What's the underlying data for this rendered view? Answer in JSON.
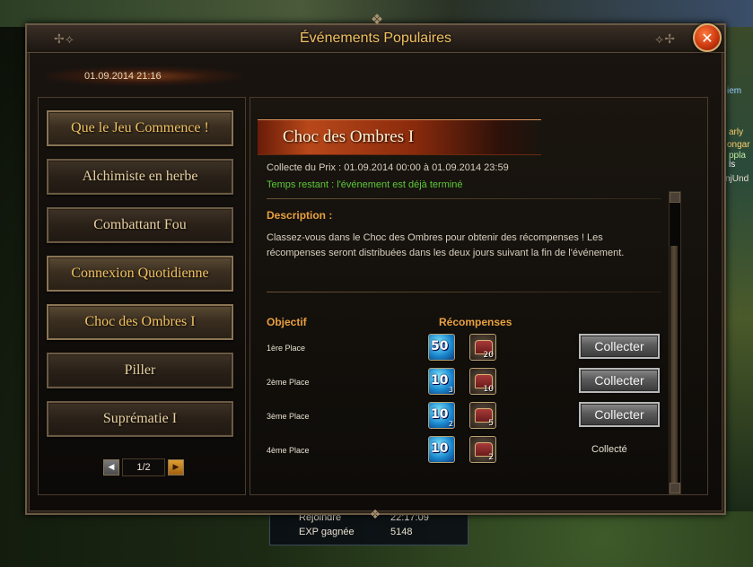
{
  "window": {
    "title": "Événements Populaires"
  },
  "date": "01.09.2014 21:16",
  "events": [
    {
      "label": "Que le Jeu Commence !"
    },
    {
      "label": "Alchimiste en herbe"
    },
    {
      "label": "Combattant Fou"
    },
    {
      "label": "Connexion Quotidienne"
    },
    {
      "label": "Choc des Ombres I"
    },
    {
      "label": "Piller"
    },
    {
      "label": "Suprématie I"
    }
  ],
  "pager": {
    "page": "1/2"
  },
  "detail": {
    "title": "Choc des Ombres I",
    "collect_period": "Collecte du Prix : 01.09.2014 00:00 à 01.09.2014 23:59",
    "time_left": "Temps restant : l'événement est déjà terminé",
    "description_title": "Description :",
    "description": "Classez-vous dans le Choc des Ombres pour obtenir des récompenses ! Les récompenses seront distribuées dans les deux jours suivant la fin de l'événement.",
    "objective_header": "Objectif",
    "rewards_header": "Récompenses",
    "rows": [
      {
        "place": "1ère Place",
        "coin": "50",
        "coin_sub": "",
        "chest_qty": "20",
        "action": "Collecter"
      },
      {
        "place": "2ème Place",
        "coin": "10",
        "coin_sub": "3",
        "chest_qty": "10",
        "action": "Collecter"
      },
      {
        "place": "3ème Place",
        "coin": "10",
        "coin_sub": "2",
        "chest_qty": "5",
        "action": "Collecter"
      },
      {
        "place": "4ème Place",
        "coin": "10",
        "coin_sub": "",
        "chest_qty": "2",
        "status": "Collecté"
      }
    ]
  },
  "background_stats": {
    "rejoindre_label": "Rejoindre",
    "rejoindre_value": "22:17:09",
    "exp_label": "EXP gagnée",
    "exp_value": "5148"
  },
  "side_texts": [
    "iem",
    "arly",
    "ongar",
    "ppla",
    "ls",
    "njUnd"
  ]
}
